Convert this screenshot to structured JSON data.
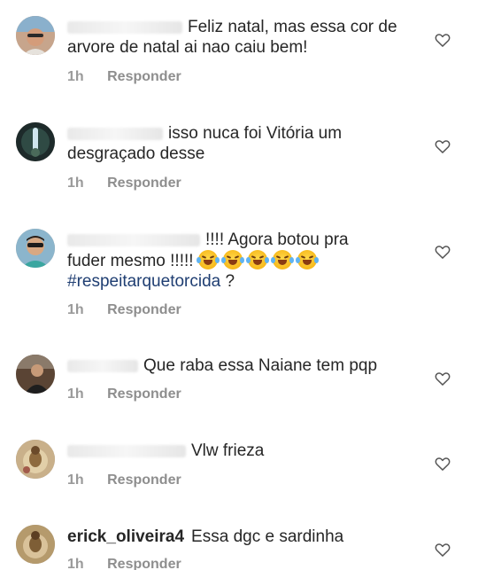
{
  "comments": [
    {
      "username": "",
      "text": "Feliz natal, mas essa cor de arvore de natal ai nao caiu bem!",
      "time": "1h",
      "reply": "Responder",
      "avatar_color": "#b08870"
    },
    {
      "username": "",
      "text": "isso nuca foi Vitória um desgraçado desse",
      "time": "1h",
      "reply": "Responder",
      "avatar_color": "#3b4a3a"
    },
    {
      "username": "",
      "text_line1": "!!!! Agora botou pra",
      "text_line2": "fuder mesmo !!!!!",
      "emoji_count": 5,
      "emoji": "face-with-tears-of-joy",
      "hashtag": "#respeitarquetorcida",
      "text_suffix": "?",
      "time": "1h",
      "reply": "Responder",
      "avatar_color": "#4a7a9a"
    },
    {
      "username": "",
      "text": "Que raba essa Naiane tem pqp",
      "time": "1h",
      "reply": "Responder",
      "avatar_color": "#6a5040"
    },
    {
      "username": "",
      "text": "Vlw frieza",
      "time": "1h",
      "reply": "Responder",
      "avatar_color": "#b89a70"
    },
    {
      "username": "erick_oliveira4",
      "text": "Essa dgc e sardinha",
      "time": "1h",
      "reply": "Responder",
      "avatar_color": "#a88a60"
    }
  ],
  "icons": {
    "like": "heart-outline-icon"
  },
  "colors": {
    "text": "#262626",
    "meta": "#8e8e8e",
    "hashtag": "#1f3e72"
  }
}
